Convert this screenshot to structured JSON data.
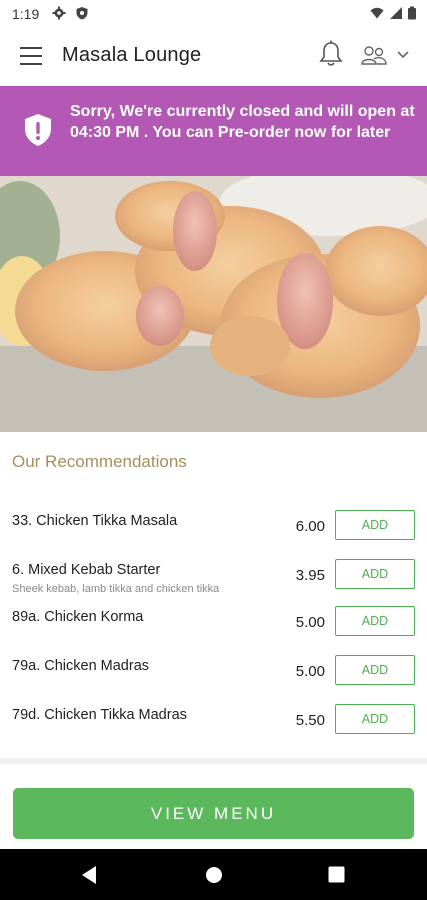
{
  "status_bar": {
    "time": "1:19",
    "icons": [
      "gear-icon",
      "shield-icon",
      "wifi-icon",
      "signal-icon",
      "battery-icon"
    ]
  },
  "app_bar": {
    "title": "Masala Lounge",
    "icons": [
      "menu-icon",
      "bell-icon",
      "account-icon",
      "chevron-down-icon"
    ]
  },
  "banner": {
    "message": "Sorry, We're currently closed and will open at 04:30 PM . You can Pre-order now for later",
    "color": "#b359b5"
  },
  "recommendations": {
    "title": "Our Recommendations",
    "add_label": "ADD",
    "items": [
      {
        "name": "33. Chicken Tikka Masala",
        "description": "",
        "price": "6.00"
      },
      {
        "name": "6. Mixed Kebab Starter",
        "description": "Sheek kebab, lamb tikka and chicken tikka",
        "price": "3.95"
      },
      {
        "name": "89a. Chicken Korma",
        "description": "",
        "price": "5.00"
      },
      {
        "name": "79a. Chicken Madras",
        "description": "",
        "price": "5.00"
      },
      {
        "name": "79d. Chicken Tikka Madras",
        "description": "",
        "price": "5.50"
      }
    ]
  },
  "view_menu": {
    "label": "VIEW MENU",
    "color": "#5cb85c"
  },
  "colors": {
    "accent_green": "#4caf50",
    "section_title": "#a68e5d"
  }
}
